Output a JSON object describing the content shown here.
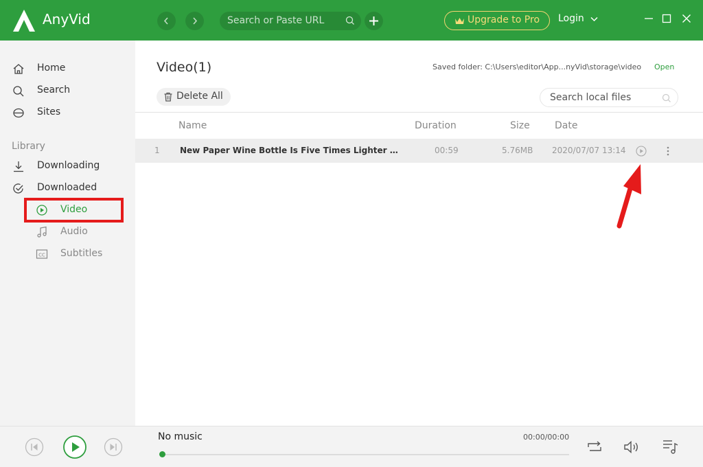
{
  "app": {
    "name": "AnyVid",
    "brand_color": "#2e9e3e",
    "search_placeholder": "Search or Paste URL",
    "upgrade_label": "Upgrade to Pro",
    "login_label": "Login"
  },
  "sidebar": {
    "items": [
      {
        "label": "Home",
        "icon": "home-icon"
      },
      {
        "label": "Search",
        "icon": "search-icon"
      },
      {
        "label": "Sites",
        "icon": "globe-icon"
      }
    ],
    "section_label": "Library",
    "library": [
      {
        "label": "Downloading",
        "icon": "download-icon"
      },
      {
        "label": "Downloaded",
        "icon": "check-circle-icon"
      }
    ],
    "sub_items": [
      {
        "label": "Video",
        "icon": "play-circle-icon",
        "active": true
      },
      {
        "label": "Audio",
        "icon": "music-note-icon",
        "active": false
      },
      {
        "label": "Subtitles",
        "icon": "cc-icon",
        "active": false
      }
    ]
  },
  "main": {
    "title": "Video(1)",
    "saved_folder": "Saved folder: C:\\Users\\editor\\App...nyVid\\storage\\video",
    "open_label": "Open",
    "delete_all_label": "Delete All",
    "local_search_placeholder": "Search local files",
    "columns": [
      "Name",
      "Duration",
      "Size",
      "Date"
    ],
    "rows": [
      {
        "index": "1",
        "name": "New Paper Wine Bottle Is Five Times Lighter Than Gl...",
        "duration": "00:59",
        "size": "5.76MB",
        "date": "2020/07/07 13:14"
      }
    ]
  },
  "player": {
    "now_playing": "No music",
    "time": "00:00/00:00",
    "progress": 0
  }
}
